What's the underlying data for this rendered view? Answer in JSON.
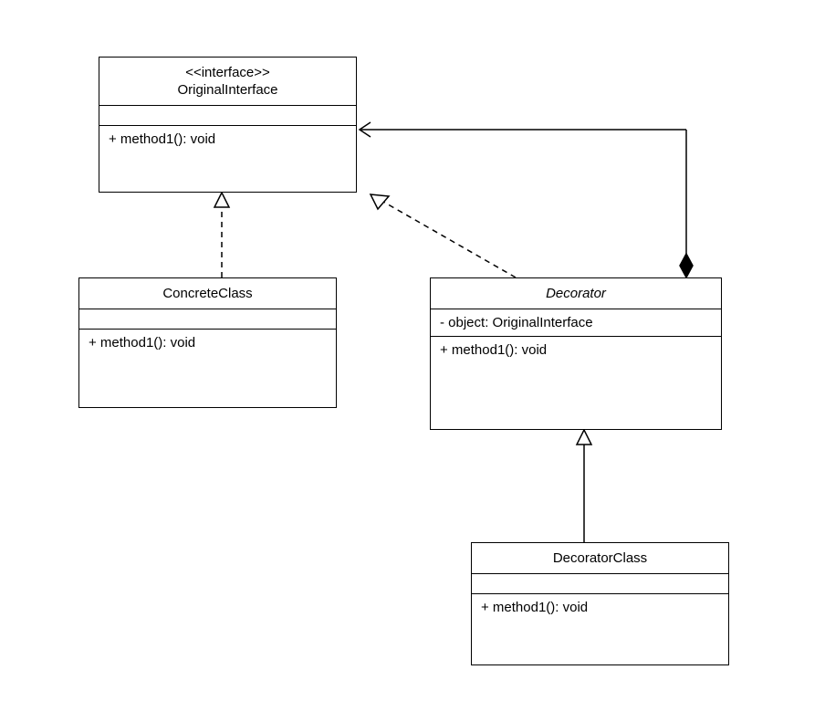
{
  "classes": {
    "original": {
      "stereotype": "<<interface>>",
      "name": "OriginalInterface",
      "method": "+ method1(): void"
    },
    "concrete": {
      "name": "ConcreteClass",
      "method": "+ method1(): void"
    },
    "decorator": {
      "name": "Decorator",
      "attribute": "- object: OriginalInterface",
      "method": "+ method1(): void"
    },
    "decoratorClass": {
      "name": "DecoratorClass",
      "method": "+ method1(): void"
    }
  },
  "chart_data": {
    "type": "uml-class-diagram",
    "pattern": "Decorator",
    "classes": [
      {
        "name": "OriginalInterface",
        "stereotype": "interface",
        "abstract": true,
        "attributes": [],
        "methods": [
          {
            "name": "method1",
            "return": "void",
            "visibility": "public"
          }
        ]
      },
      {
        "name": "ConcreteClass",
        "abstract": false,
        "attributes": [],
        "methods": [
          {
            "name": "method1",
            "return": "void",
            "visibility": "public"
          }
        ]
      },
      {
        "name": "Decorator",
        "abstract": true,
        "attributes": [
          {
            "name": "object",
            "type": "OriginalInterface",
            "visibility": "private"
          }
        ],
        "methods": [
          {
            "name": "method1",
            "return": "void",
            "visibility": "public"
          }
        ]
      },
      {
        "name": "DecoratorClass",
        "abstract": false,
        "attributes": [],
        "methods": [
          {
            "name": "method1",
            "return": "void",
            "visibility": "public"
          }
        ]
      }
    ],
    "relationships": [
      {
        "from": "ConcreteClass",
        "to": "OriginalInterface",
        "type": "realization"
      },
      {
        "from": "Decorator",
        "to": "OriginalInterface",
        "type": "realization"
      },
      {
        "from": "Decorator",
        "to": "OriginalInterface",
        "type": "composition",
        "direction": "whole-at-decorator"
      },
      {
        "from": "DecoratorClass",
        "to": "Decorator",
        "type": "generalization"
      }
    ]
  }
}
